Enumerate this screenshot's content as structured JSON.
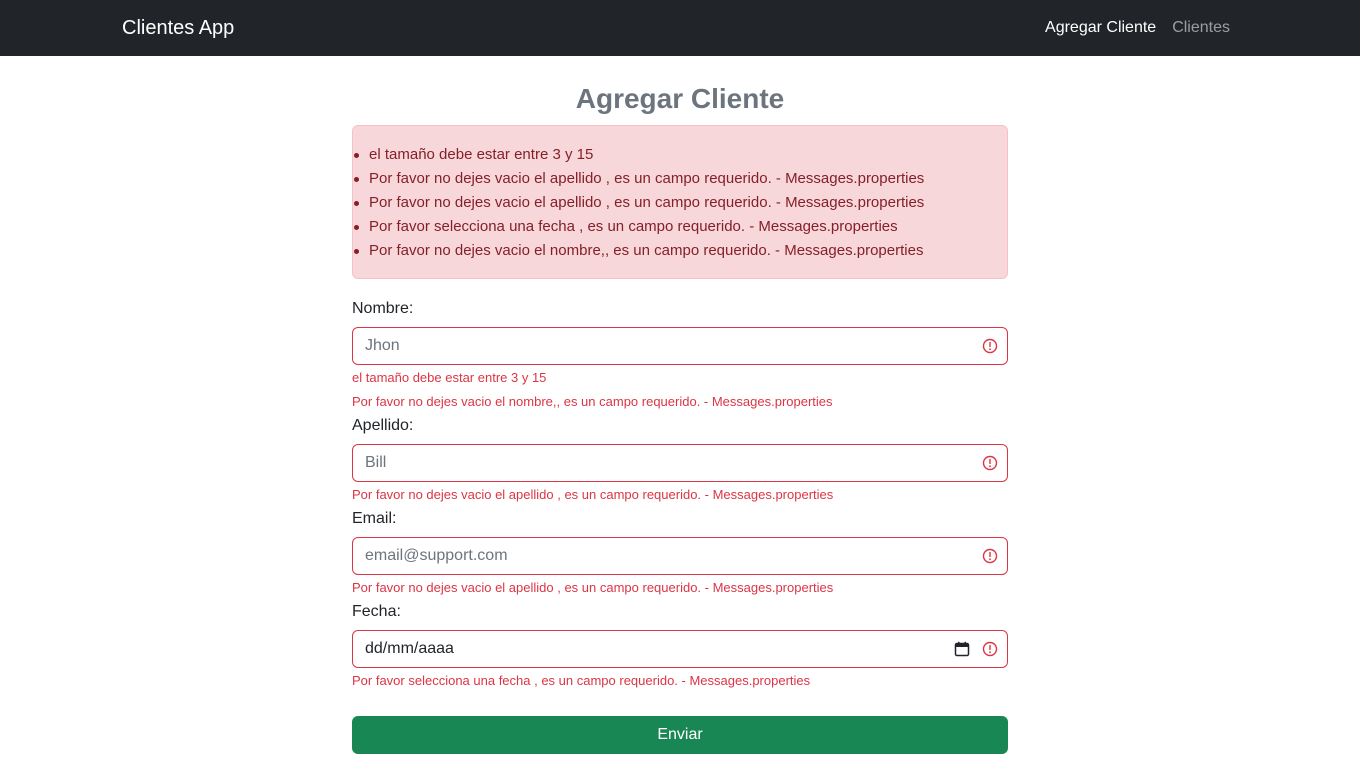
{
  "navbar": {
    "brand": "Clientes App",
    "links": [
      {
        "label": "Agregar Cliente",
        "active": true
      },
      {
        "label": "Clientes",
        "active": false
      }
    ]
  },
  "page": {
    "title": "Agregar Cliente"
  },
  "alert": {
    "messages": [
      "el tamaño debe estar entre 3 y 15",
      "Por favor no dejes vacio el apellido , es un campo requerido. - Messages.properties",
      "Por favor no dejes vacio el apellido , es un campo requerido. - Messages.properties",
      "Por favor selecciona una fecha , es un campo requerido. - Messages.properties",
      "Por favor no dejes vacio el nombre,, es un campo requerido. - Messages.properties"
    ]
  },
  "form": {
    "nombre": {
      "label": "Nombre:",
      "placeholder": "Jhon",
      "errors": [
        "el tamaño debe estar entre 3 y 15",
        "Por favor no dejes vacio el nombre,, es un campo requerido. - Messages.properties"
      ]
    },
    "apellido": {
      "label": "Apellido:",
      "placeholder": "Bill",
      "errors": [
        "Por favor no dejes vacio el apellido , es un campo requerido. - Messages.properties"
      ]
    },
    "email": {
      "label": "Email:",
      "placeholder": "email@support.com",
      "errors": [
        "Por favor no dejes vacio el apellido , es un campo requerido. - Messages.properties"
      ]
    },
    "fecha": {
      "label": "Fecha:",
      "placeholder": "dd/mm/aaaa",
      "errors": [
        "Por favor selecciona una fecha , es un campo requerido. - Messages.properties"
      ]
    },
    "submit_label": "Enviar"
  },
  "colors": {
    "navbar_bg": "#212529",
    "danger": "#dc3545",
    "alert_bg": "#f8d7da",
    "alert_text": "#842029",
    "success": "#198754",
    "title": "#6c757d"
  },
  "icons": {
    "invalid": "exclamation-circle-icon",
    "calendar": "calendar-icon"
  }
}
